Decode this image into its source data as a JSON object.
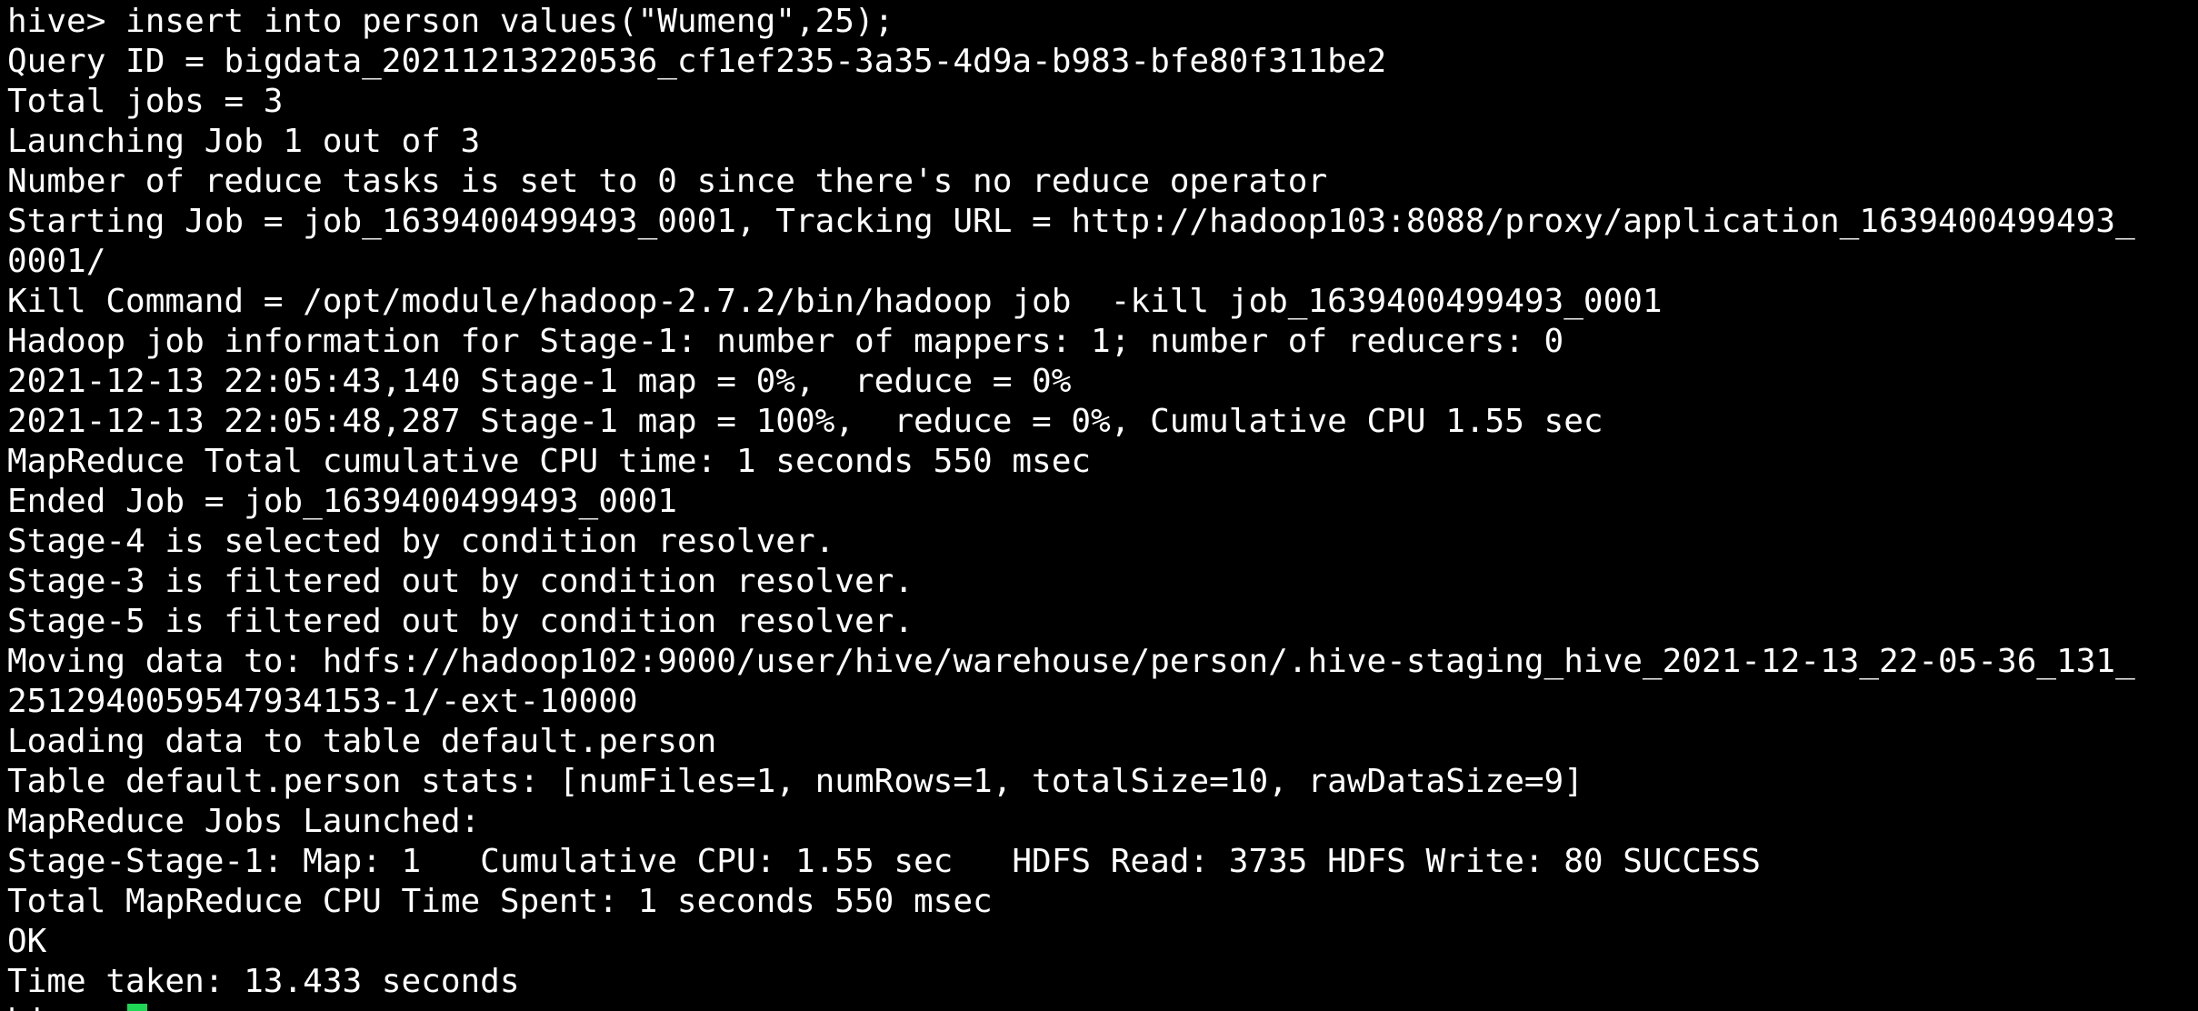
{
  "terminal": {
    "lines": [
      "hive> insert into person values(\"Wumeng\",25);",
      "Query ID = bigdata_20211213220536_cf1ef235-3a35-4d9a-b983-bfe80f311be2",
      "Total jobs = 3",
      "Launching Job 1 out of 3",
      "Number of reduce tasks is set to 0 since there's no reduce operator",
      "Starting Job = job_1639400499493_0001, Tracking URL = http://hadoop103:8088/proxy/application_1639400499493_",
      "0001/",
      "Kill Command = /opt/module/hadoop-2.7.2/bin/hadoop job  -kill job_1639400499493_0001",
      "Hadoop job information for Stage-1: number of mappers: 1; number of reducers: 0",
      "2021-12-13 22:05:43,140 Stage-1 map = 0%,  reduce = 0%",
      "2021-12-13 22:05:48,287 Stage-1 map = 100%,  reduce = 0%, Cumulative CPU 1.55 sec",
      "MapReduce Total cumulative CPU time: 1 seconds 550 msec",
      "Ended Job = job_1639400499493_0001",
      "Stage-4 is selected by condition resolver.",
      "Stage-3 is filtered out by condition resolver.",
      "Stage-5 is filtered out by condition resolver.",
      "Moving data to: hdfs://hadoop102:9000/user/hive/warehouse/person/.hive-staging_hive_2021-12-13_22-05-36_131_",
      "2512940059547934153-1/-ext-10000",
      "Loading data to table default.person",
      "Table default.person stats: [numFiles=1, numRows=1, totalSize=10, rawDataSize=9]",
      "MapReduce Jobs Launched:",
      "Stage-Stage-1: Map: 1   Cumulative CPU: 1.55 sec   HDFS Read: 3735 HDFS Write: 80 SUCCESS",
      "Total MapReduce CPU Time Spent: 1 seconds 550 msec",
      "OK",
      "Time taken: 13.433 seconds"
    ],
    "prompt": "hive> ",
    "colors": {
      "background": "#000000",
      "text": "#ffffff",
      "cursor": "#1fd655"
    }
  }
}
